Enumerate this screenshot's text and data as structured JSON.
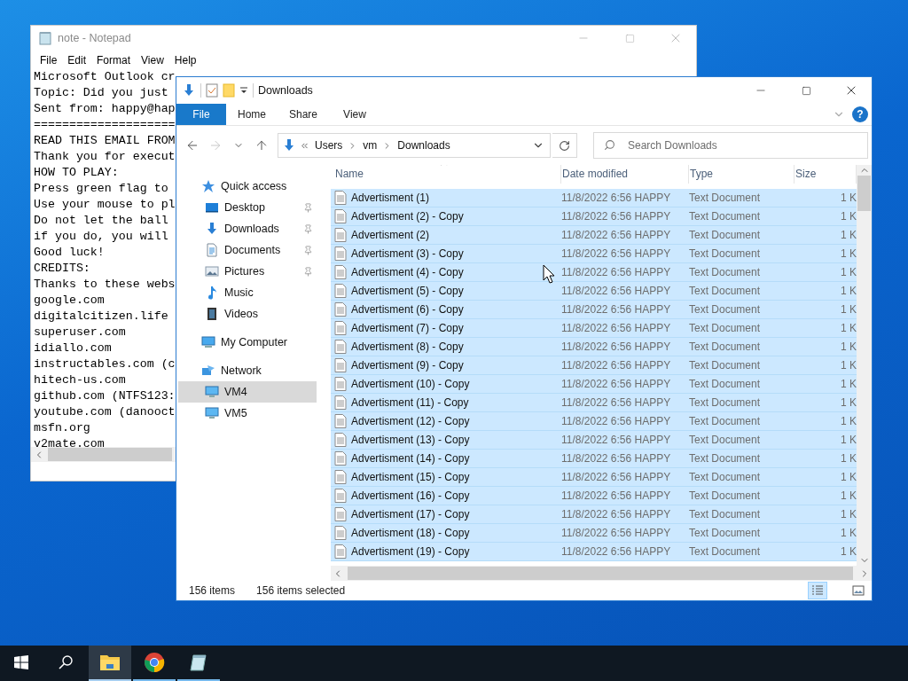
{
  "notepad": {
    "title": "note - Notepad",
    "menu": [
      "File",
      "Edit",
      "Format",
      "View",
      "Help"
    ],
    "lines": [
      "Microsoft Outlook cr",
      "Topic: Did you just",
      "Sent from: happy@hap",
      "====================",
      "READ THIS EMAIL FROM",
      "Thank you for execut",
      "HOW TO PLAY:",
      "Press green flag to",
      "Use your mouse to pl",
      "Do not let the ball",
      "if you do, you will",
      "Good luck!",
      "CREDITS:",
      "Thanks to these webs",
      "google.com",
      "digitalcitizen.life",
      "superuser.com",
      "idiallo.com",
      "instructables.com (c",
      "hitech-us.com",
      "github.com (NTFS123:",
      "youtube.com (danooct",
      "msfn.org",
      "v2mate.com"
    ]
  },
  "explorer": {
    "title": "Downloads",
    "ribbon_tabs": [
      {
        "label": "File",
        "kind": "file"
      },
      {
        "label": "Home",
        "kind": "tab"
      },
      {
        "label": "Share",
        "kind": "tab"
      },
      {
        "label": "View",
        "kind": "tab"
      }
    ],
    "help": "?",
    "breadcrumb": [
      "Users",
      "vm",
      "Downloads"
    ],
    "search": {
      "placeholder": "Search Downloads"
    },
    "nav": [
      {
        "label": "Quick access",
        "kind": "star",
        "selected": false,
        "children": [
          {
            "label": "Desktop",
            "kind": "desktop",
            "pinned": true,
            "selected": false
          },
          {
            "label": "Downloads",
            "kind": "download",
            "pinned": true,
            "selected": false
          },
          {
            "label": "Documents",
            "kind": "document",
            "pinned": true,
            "selected": false
          },
          {
            "label": "Pictures",
            "kind": "picture",
            "pinned": true,
            "selected": false
          },
          {
            "label": "Music",
            "kind": "music",
            "pinned": false,
            "selected": false
          },
          {
            "label": "Videos",
            "kind": "video",
            "pinned": false,
            "selected": false
          }
        ]
      },
      {
        "label": "My Computer",
        "kind": "computer",
        "selected": false
      },
      {
        "label": "Network",
        "kind": "network",
        "selected": false,
        "children": [
          {
            "label": "VM4",
            "kind": "monitor",
            "pinned": false,
            "selected": true
          },
          {
            "label": "VM5",
            "kind": "monitor",
            "pinned": false,
            "selected": false
          }
        ]
      }
    ],
    "columns": [
      "Name",
      "Date modified",
      "Type",
      "Size"
    ],
    "rows": [
      {
        "name": "Advertisment (1)",
        "date": "11/8/2022 6:56 HAPPY",
        "type": "Text Document",
        "size": "1 K",
        "selected": true
      },
      {
        "name": "Advertisment (2) - Copy",
        "date": "11/8/2022 6:56 HAPPY",
        "type": "Text Document",
        "size": "1 K",
        "selected": true
      },
      {
        "name": "Advertisment (2)",
        "date": "11/8/2022 6:56 HAPPY",
        "type": "Text Document",
        "size": "1 K",
        "selected": true
      },
      {
        "name": "Advertisment (3) - Copy",
        "date": "11/8/2022 6:56 HAPPY",
        "type": "Text Document",
        "size": "1 K",
        "selected": true
      },
      {
        "name": "Advertisment (4) - Copy",
        "date": "11/8/2022 6:56 HAPPY",
        "type": "Text Document",
        "size": "1 K",
        "selected": true
      },
      {
        "name": "Advertisment (5) - Copy",
        "date": "11/8/2022 6:56 HAPPY",
        "type": "Text Document",
        "size": "1 K",
        "selected": true
      },
      {
        "name": "Advertisment (6) - Copy",
        "date": "11/8/2022 6:56 HAPPY",
        "type": "Text Document",
        "size": "1 K",
        "selected": true
      },
      {
        "name": "Advertisment (7) - Copy",
        "date": "11/8/2022 6:56 HAPPY",
        "type": "Text Document",
        "size": "1 K",
        "selected": true
      },
      {
        "name": "Advertisment (8) - Copy",
        "date": "11/8/2022 6:56 HAPPY",
        "type": "Text Document",
        "size": "1 K",
        "selected": true
      },
      {
        "name": "Advertisment (9) - Copy",
        "date": "11/8/2022 6:56 HAPPY",
        "type": "Text Document",
        "size": "1 K",
        "selected": true
      },
      {
        "name": "Advertisment (10) - Copy",
        "date": "11/8/2022 6:56 HAPPY",
        "type": "Text Document",
        "size": "1 K",
        "selected": true
      },
      {
        "name": "Advertisment (11) - Copy",
        "date": "11/8/2022 6:56 HAPPY",
        "type": "Text Document",
        "size": "1 K",
        "selected": true
      },
      {
        "name": "Advertisment (12) - Copy",
        "date": "11/8/2022 6:56 HAPPY",
        "type": "Text Document",
        "size": "1 K",
        "selected": true
      },
      {
        "name": "Advertisment (13) - Copy",
        "date": "11/8/2022 6:56 HAPPY",
        "type": "Text Document",
        "size": "1 K",
        "selected": true
      },
      {
        "name": "Advertisment (14) - Copy",
        "date": "11/8/2022 6:56 HAPPY",
        "type": "Text Document",
        "size": "1 K",
        "selected": true
      },
      {
        "name": "Advertisment (15) - Copy",
        "date": "11/8/2022 6:56 HAPPY",
        "type": "Text Document",
        "size": "1 K",
        "selected": true
      },
      {
        "name": "Advertisment (16) - Copy",
        "date": "11/8/2022 6:56 HAPPY",
        "type": "Text Document",
        "size": "1 K",
        "selected": true
      },
      {
        "name": "Advertisment (17) - Copy",
        "date": "11/8/2022 6:56 HAPPY",
        "type": "Text Document",
        "size": "1 K",
        "selected": true
      },
      {
        "name": "Advertisment (18) - Copy",
        "date": "11/8/2022 6:56 HAPPY",
        "type": "Text Document",
        "size": "1 K",
        "selected": true
      },
      {
        "name": "Advertisment (19) - Copy",
        "date": "11/8/2022 6:56 HAPPY",
        "type": "Text Document",
        "size": "1 K",
        "selected": true
      }
    ],
    "status": {
      "count": "156 items",
      "selection": "156 items selected"
    }
  },
  "taskbar": {
    "apps": [
      {
        "kind": "start",
        "selected": false,
        "running": false
      },
      {
        "kind": "search",
        "selected": false,
        "running": false
      },
      {
        "kind": "explorer",
        "selected": true,
        "running": true
      },
      {
        "kind": "chrome",
        "selected": false,
        "running": true
      },
      {
        "kind": "notepad",
        "selected": false,
        "running": true
      }
    ]
  }
}
